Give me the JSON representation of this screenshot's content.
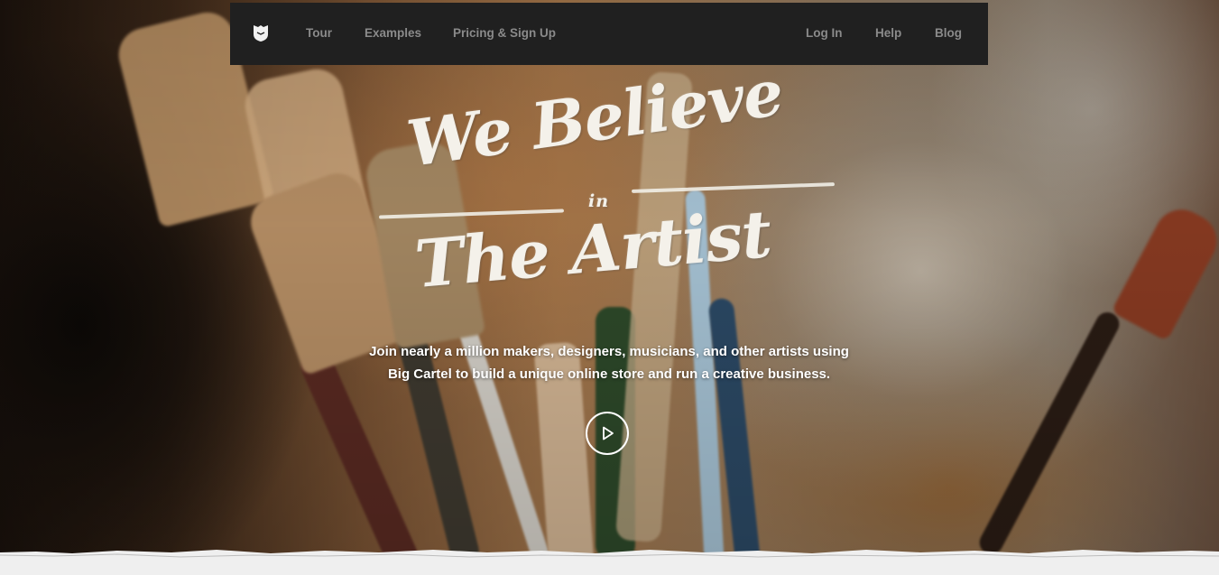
{
  "nav": {
    "logo_icon": "big-cartel-logo-icon",
    "left_links": [
      "Tour",
      "Examples",
      "Pricing & Sign Up"
    ],
    "right_links": [
      "Log In",
      "Help",
      "Blog"
    ]
  },
  "hero": {
    "headline_line1": "We Believe",
    "headline_line2": "in",
    "headline_line3": "The Artist",
    "tagline_line1": "Join nearly a million makers, designers, musicians, and other artists using",
    "tagline_line2": "Big Cartel to build a unique online store and run a creative business.",
    "play_icon": "play-icon"
  },
  "colors": {
    "nav_background": "#202020",
    "nav_text": "#8a8a8a",
    "headline_text": "#f4f1ea",
    "page_background": "#efefef"
  }
}
